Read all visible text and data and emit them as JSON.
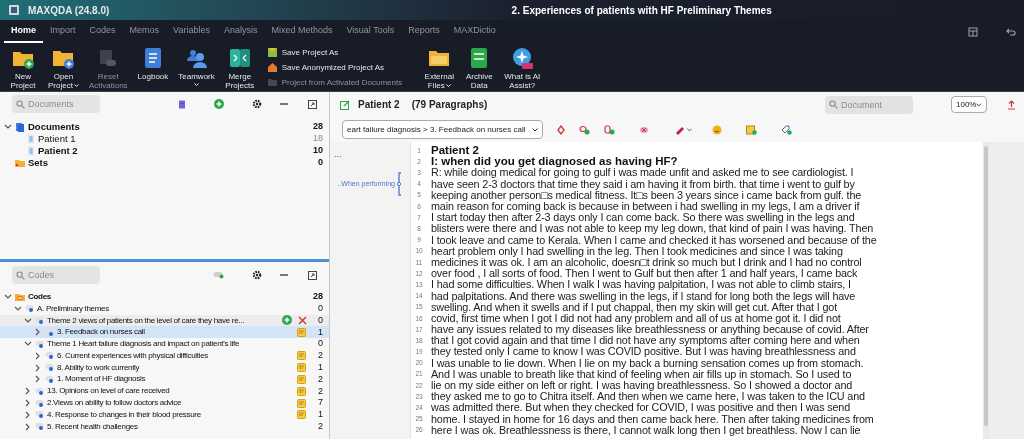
{
  "app": {
    "name": "MAXQDA (24.8.0)",
    "title": "2. Experiences of patients with HF Preliminary Themes"
  },
  "tabs": [
    {
      "label": "Home",
      "selected": true
    },
    {
      "label": "Import",
      "selected": false
    },
    {
      "label": "Codes",
      "selected": false
    },
    {
      "label": "Memos",
      "selected": false
    },
    {
      "label": "Variables",
      "selected": false
    },
    {
      "label": "Analysis",
      "selected": false
    },
    {
      "label": "Mixed Methods",
      "selected": false
    },
    {
      "label": "Visual Tools",
      "selected": false
    },
    {
      "label": "Reports",
      "selected": false
    },
    {
      "label": "MAXDictio",
      "selected": false
    }
  ],
  "ribbon": [
    {
      "kind": "large",
      "lines": [
        "New",
        "Project"
      ],
      "dropdown": false,
      "disabled": false
    },
    {
      "kind": "large",
      "lines": [
        "Open",
        "Project"
      ],
      "dropdown": true,
      "disabled": false
    },
    {
      "kind": "large",
      "lines": [
        "Reset",
        "Activations"
      ],
      "dropdown": false,
      "disabled": true
    },
    {
      "kind": "large",
      "lines": [
        "Logbook"
      ],
      "dropdown": false,
      "disabled": false
    },
    {
      "kind": "large",
      "lines": [
        "Teamwork"
      ],
      "dropdown": true,
      "disabled": false
    },
    {
      "kind": "large",
      "lines": [
        "Merge",
        "Projects"
      ],
      "dropdown": false,
      "disabled": false
    },
    {
      "kind": "small",
      "items": [
        {
          "label": "Save Project As",
          "disabled": false
        },
        {
          "label": "Save Anonymized Project As",
          "disabled": false
        },
        {
          "label": "Project from Activated Documents",
          "disabled": true
        }
      ]
    },
    {
      "kind": "large",
      "lines": [
        "External",
        "Files"
      ],
      "dropdown": true,
      "disabled": false
    },
    {
      "kind": "large",
      "lines": [
        "Archive",
        "Data"
      ],
      "dropdown": false,
      "disabled": false
    },
    {
      "kind": "large",
      "lines": [
        "What is AI",
        "Assist?"
      ],
      "dropdown": false,
      "disabled": false
    }
  ],
  "documents_panel": {
    "search_placeholder": "Documents",
    "tree": [
      {
        "kind": "group",
        "label": "Documents",
        "count": "28",
        "expanded": true,
        "children": [
          {
            "kind": "document",
            "label": "Patient 1",
            "count": "18",
            "selected": false
          },
          {
            "kind": "document",
            "label": "Patient 2",
            "count": "10",
            "selected": true
          }
        ]
      },
      {
        "kind": "sets",
        "label": "Sets",
        "count": "0"
      }
    ]
  },
  "codes_panel": {
    "search_placeholder": "Codes",
    "tree": [
      {
        "label": "Codes",
        "count": "28",
        "expanded": true,
        "memo": false,
        "selected": false,
        "children": [
          {
            "label": "A. Preliminary themes",
            "count": "0",
            "expanded": true,
            "memo": false,
            "selected": false,
            "children": [
              {
                "label": "Theme 2 views of patients on the level of care they have re...",
                "count": "0",
                "expanded": true,
                "memo": false,
                "selected": false,
                "hovered": true,
                "children": [
                  {
                    "label": "3. Feedback on nurses call",
                    "count": "1",
                    "expanded": false,
                    "memo": true,
                    "selected": true
                  }
                ]
              },
              {
                "label": "Theme 1 Heart failure diagnosis and impact on patient's life",
                "count": "0",
                "expanded": true,
                "memo": false,
                "selected": false,
                "children": [
                  {
                    "label": "6. Current experiences with physical difficulties",
                    "count": "2",
                    "expanded": false,
                    "memo": true,
                    "selected": false
                  },
                  {
                    "label": "8. Ability to work currently",
                    "count": "1",
                    "expanded": false,
                    "memo": true,
                    "selected": false
                  },
                  {
                    "label": "1. Moment of HF diagnosis",
                    "count": "2",
                    "expanded": false,
                    "memo": true,
                    "selected": false
                  }
                ]
              },
              {
                "label": "13. Opinions on level of care received",
                "count": "2",
                "expanded": false,
                "memo": true,
                "selected": false
              },
              {
                "label": "2.Views on ability to follow doctors advice",
                "count": "7",
                "expanded": false,
                "memo": true,
                "selected": false
              },
              {
                "label": "4. Response to changes in their blood pressure",
                "count": "1",
                "expanded": false,
                "memo": true,
                "selected": false
              },
              {
                "label": "5.  Recent health challenges",
                "count": "2",
                "expanded": false,
                "memo": false,
                "selected": false
              }
            ]
          }
        ]
      }
    ]
  },
  "document_browser": {
    "document": "Patient 2",
    "paragraphs": "(79 Paragraphs)",
    "search_placeholder": "Document",
    "zoom": "100%",
    "code_path": "eart failure diagnosis  > 3. Feedback on nurses call",
    "margin": {
      "more": "...",
      "coding": "..When performing"
    },
    "lines": [
      {
        "number": "1",
        "text": "Patient 2",
        "kind": "heading"
      },
      {
        "number": "2",
        "text": "I: when did you get diagnosed as having HF?",
        "kind": "heading"
      },
      {
        "number": "3",
        "text": "R: while doing medical for going to gulf i was made unfit and asked me to see cardiologist. I",
        "kind": "body"
      },
      {
        "number": "4",
        "text": "have seen 2-3 doctors that time they said i am having it from birth. that time i went to gulf by",
        "kind": "body"
      },
      {
        "number": "5",
        "text": "keeping another person□s medical fitness. It□s been 3 years since i came back from gulf. the",
        "kind": "body"
      },
      {
        "number": "6",
        "text": "main reason for coming back is because in between i had swelling in my legs, I am a driver if",
        "kind": "body"
      },
      {
        "number": "7",
        "text": "I start today then after 2-3 days only I can come back. So there was swelling in the legs and",
        "kind": "body"
      },
      {
        "number": "8",
        "text": "blisters were there and I was not able to keep my leg down, that kind of pain I was having. Then",
        "kind": "body"
      },
      {
        "number": "9",
        "text": "I took leave and came to Kerala. When I came and checked it has worsened and because of the",
        "kind": "body"
      },
      {
        "number": "10",
        "text": "heart problem only I had swelling in the leg. Then I took medicines and since I was taking",
        "kind": "body"
      },
      {
        "number": "11",
        "text": "medicines it was ok. I am an alcoholic, doesn□t drink so much but I drink and I had no control",
        "kind": "body"
      },
      {
        "number": "12",
        "text": "over food , I all sorts of food. Then I went to Gulf but then after 1 and half years, I came back",
        "kind": "body"
      },
      {
        "number": "13",
        "text": "I had some difficulties. When I walk I was having palpitation, I was not able to climb stairs, I",
        "kind": "body"
      },
      {
        "number": "14",
        "text": "had palpitations. And there was swelling in the legs, if I stand for long both the legs will have",
        "kind": "body"
      },
      {
        "number": "15",
        "text": "swelling. And when it swells and if I put chappal, then my skin will get cut. After that I got",
        "kind": "body"
      },
      {
        "number": "16",
        "text": "covid, first time when I got I did not had any problem and all of us at home got it. I did not",
        "kind": "body"
      },
      {
        "number": "17",
        "text": "have any issues related to my diseases like breathlessness or anything because of covid. After",
        "kind": "body"
      },
      {
        "number": "18",
        "text": "that I got covid again and that time I did not have any symptoms after coming here and when",
        "kind": "body"
      },
      {
        "number": "19",
        "text": "they tested only I came to know I was COVID positive. But I was having breathlessness and",
        "kind": "body"
      },
      {
        "number": "20",
        "text": "I was unable to lie down. When I lie on my back a burning sensation comes up from stomach.",
        "kind": "body"
      },
      {
        "number": "21",
        "text": "And I was unable to breath like that kind of feeling when air fills up in stomach. So I used to",
        "kind": "body"
      },
      {
        "number": "22",
        "text": "lie on my side either on left or right. I was having breathlessness. So I showed a doctor and",
        "kind": "body"
      },
      {
        "number": "23",
        "text": "they asked me to go to Chitra itself. And then when we came here, I was taken to the ICU and",
        "kind": "body"
      },
      {
        "number": "24",
        "text": "was admitted there. But when they checked for COVID, I was positive and then I was send",
        "kind": "body"
      },
      {
        "number": "25",
        "text": "home. I stayed in home for 16 days and then came back here. Then after taking medicines from",
        "kind": "body"
      },
      {
        "number": "26",
        "text": "here I was ok. Breathlessness is there, I cannot walk long then I get breathless. Now I can lie",
        "kind": "body"
      }
    ]
  }
}
